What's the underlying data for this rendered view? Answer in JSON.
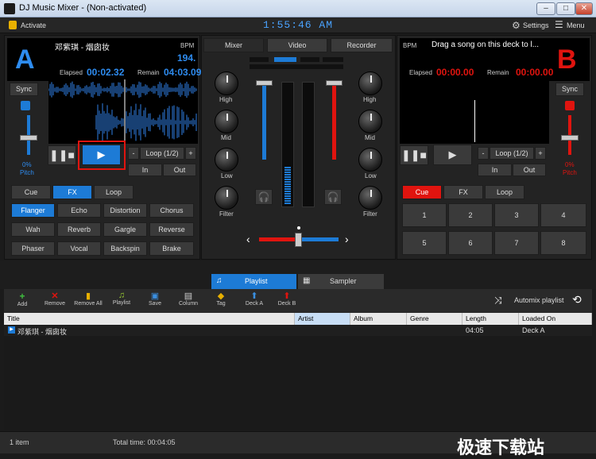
{
  "window": {
    "title": "DJ Music Mixer - (Non-activated)",
    "min": "–",
    "max": "□",
    "close": "✕"
  },
  "topbar": {
    "activate": "Activate",
    "clock": "1:55:46 AM",
    "settings": "Settings",
    "menu": "Menu"
  },
  "deckA": {
    "letter": "A",
    "track": "邓紫琪 - 烟囱妆",
    "bpm_label": "BPM",
    "bpm": "194.",
    "elapsed_label": "Elapsed",
    "elapsed": "00:02.32",
    "remain_label": "Remain",
    "remain": "04:03.09",
    "sync": "Sync",
    "pitch_value": "0%",
    "pitch_label": "Pitch",
    "loop_minus": "-",
    "loop": "Loop (1/2)",
    "loop_plus": "+",
    "in": "In",
    "out": "Out",
    "tabs": [
      "Cue",
      "FX",
      "Loop"
    ],
    "fx": [
      "Flanger",
      "Echo",
      "Distortion",
      "Chorus",
      "Wah",
      "Reverb",
      "Gargle",
      "Reverse",
      "Phaser",
      "Vocal",
      "Backspin",
      "Brake"
    ]
  },
  "mixer": {
    "tabs": [
      "Mixer",
      "Video",
      "Recorder"
    ],
    "knobs": [
      "High",
      "Mid",
      "Low",
      "Filter"
    ]
  },
  "deckB": {
    "letter": "B",
    "bpm_label": "BPM",
    "track": "Drag a song on this deck to l...",
    "elapsed_label": "Elapsed",
    "elapsed": "00:00.00",
    "remain_label": "Remain",
    "remain": "00:00.00",
    "sync": "Sync",
    "pitch_value": "0%",
    "pitch_label": "Pitch",
    "loop_minus": "-",
    "loop": "Loop (1/2)",
    "loop_plus": "+",
    "in": "In",
    "out": "Out",
    "tabs": [
      "Cue",
      "FX",
      "Loop"
    ],
    "pads": [
      "1",
      "2",
      "3",
      "4",
      "5",
      "6",
      "7",
      "8"
    ]
  },
  "library": {
    "tabs": [
      "Playlist",
      "Sampler"
    ],
    "tools": [
      "Add",
      "Remove",
      "Remove All",
      "Playlist",
      "Save",
      "Column",
      "Tag",
      "Deck A",
      "Deck B"
    ],
    "automix": "Automix playlist",
    "columns": [
      "Title",
      "Artist",
      "Album",
      "Genre",
      "Length",
      "Loaded On"
    ],
    "rows": [
      {
        "title": "邓紫琪 - 烟囱妆",
        "artist": "",
        "album": "",
        "genre": "",
        "length": "04:05",
        "loaded": "Deck A"
      }
    ]
  },
  "status": {
    "items": "1  item",
    "total": "Total time: 00:04:05"
  },
  "watermark": "极速下载站",
  "colors": {
    "accent_blue": "#1d7bd6",
    "accent_red": "#e0140f"
  }
}
